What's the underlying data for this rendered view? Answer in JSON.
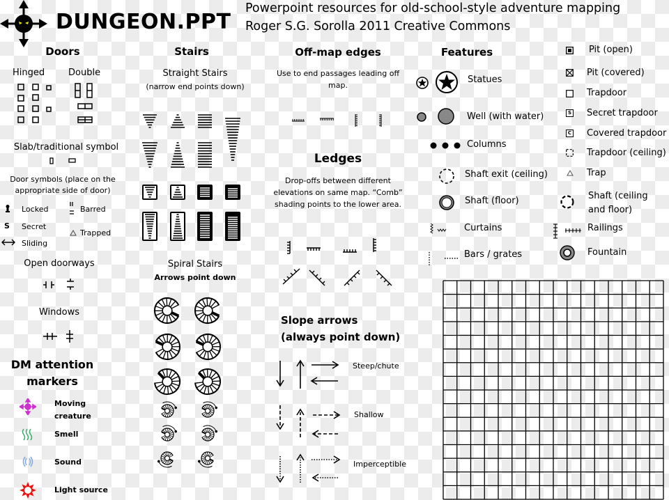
{
  "header": {
    "logo_title": "DUNGEON.PPT",
    "subtitle_line1": "Powerpoint resources for old-school-style adventure mapping",
    "subtitle_line2": "Roger S.G. Sorolla 2011 Creative Commons"
  },
  "doors": {
    "title": "Doors",
    "hinged": "Hinged",
    "double": "Double",
    "slab": "Slab/traditional symbol",
    "symbols_note": "Door symbols (place on the appropriate side of door)",
    "locked": "Locked",
    "secret": "Secret",
    "sliding": "Sliding",
    "barred": "Barred",
    "trapped": "Trapped",
    "secret_glyph": "S",
    "open_doorways": "Open doorways",
    "windows": "Windows"
  },
  "dm": {
    "title_line1": "DM attention",
    "title_line2": "markers",
    "items": [
      {
        "label_line1": "Moving",
        "label_line2": "creature",
        "icon": "moving-creature-icon",
        "color": "#cc33cc"
      },
      {
        "label_line1": "Smell",
        "label_line2": "",
        "icon": "smell-icon",
        "color": "#33aa66"
      },
      {
        "label_line1": "Sound",
        "label_line2": "",
        "icon": "sound-icon",
        "color": "#88aadd"
      },
      {
        "label_line1": "Light source",
        "label_line2": "",
        "icon": "light-source-icon",
        "color": "#ee1111"
      }
    ]
  },
  "stairs": {
    "title": "Stairs",
    "straight_title": "Straight Stairs",
    "straight_note": "(narrow end points down)",
    "spiral_title": "Spiral Stairs",
    "spiral_note": "Arrows point down"
  },
  "offmap": {
    "title": "Off-map edges",
    "note": "Use to end passages leading off map."
  },
  "ledges": {
    "title": "Ledges",
    "note": "Drop-offs between different elevations on same map. “Comb” shading points to the lower area."
  },
  "slope": {
    "title_line1": "Slope arrows",
    "title_line2": "(always point down)",
    "steep": "Steep/chute",
    "shallow": "Shallow",
    "imperceptible": "Imperceptible"
  },
  "features": {
    "title": "Features",
    "statues": "Statues",
    "well": "Well (with water)",
    "columns": "Columns",
    "shaft_exit": "Shaft exit (ceiling)",
    "shaft_floor": "Shaft (floor)",
    "curtains": "Curtains",
    "bars": "Bars / grates",
    "pit_open": "Pit (open)",
    "pit_covered": "Pit (covered)",
    "trapdoor": "Trapdoor",
    "secret_trapdoor": "Secret trapdoor",
    "covered_trapdoor": "Covered trapdoor",
    "trapdoor_ceiling": "Trapdoor (ceiling)",
    "trap": "Trap",
    "shaft_both_line1": "Shaft (ceiling",
    "shaft_both_line2": "and floor)",
    "railings": "Railings",
    "fountain": "Fountain",
    "secret_glyph": "S",
    "covered_glyph": "C"
  },
  "grid": {
    "rows": 16,
    "cols": 16
  }
}
